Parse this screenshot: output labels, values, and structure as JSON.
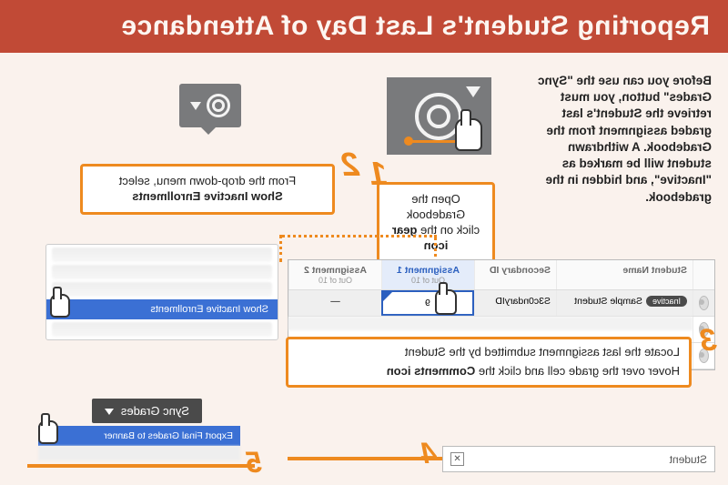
{
  "header": {
    "title": "Reporting Student's Last Day of Attendance"
  },
  "intro": "Before you can use the \"Sync Grades\" button, you must retrieve the Student's last graded assignment from the Gradebook. A withdrawn student will be marked as \"Inactive\", and hidden in the gradebook.",
  "steps": {
    "s1": {
      "num": "1",
      "text_a": "Open the Gradebook",
      "text_b": "click on the ",
      "text_bold": "gear icon"
    },
    "s2": {
      "num": "2",
      "text_a": "From the drop-down menu, select",
      "text_bold": "Show Inactive Enrollments",
      "menu_selected": "Show Inactive Enrollments"
    },
    "s3": {
      "num": "3",
      "line1": "Locate the last assignment submitted by the Student",
      "line2_a": "Hover over the grade cell and click the ",
      "line2_bold": "Comments icon"
    },
    "s4": {
      "num": "4",
      "student_label": "Student"
    },
    "s5": {
      "num": "5",
      "sync_label": "Sync Grades",
      "export_label": "Export Final Grades to Banner"
    }
  },
  "gradebook": {
    "headers": {
      "name": "Student Name",
      "id": "Secondary ID",
      "a1": "Assignment 1",
      "a2": "Assignment 2",
      "out": "Out of 10"
    },
    "row": {
      "badge": "Inactive",
      "name": "Sample Student",
      "id": "S3c0ndaryID",
      "grade1": "9",
      "grade2": "—"
    }
  }
}
